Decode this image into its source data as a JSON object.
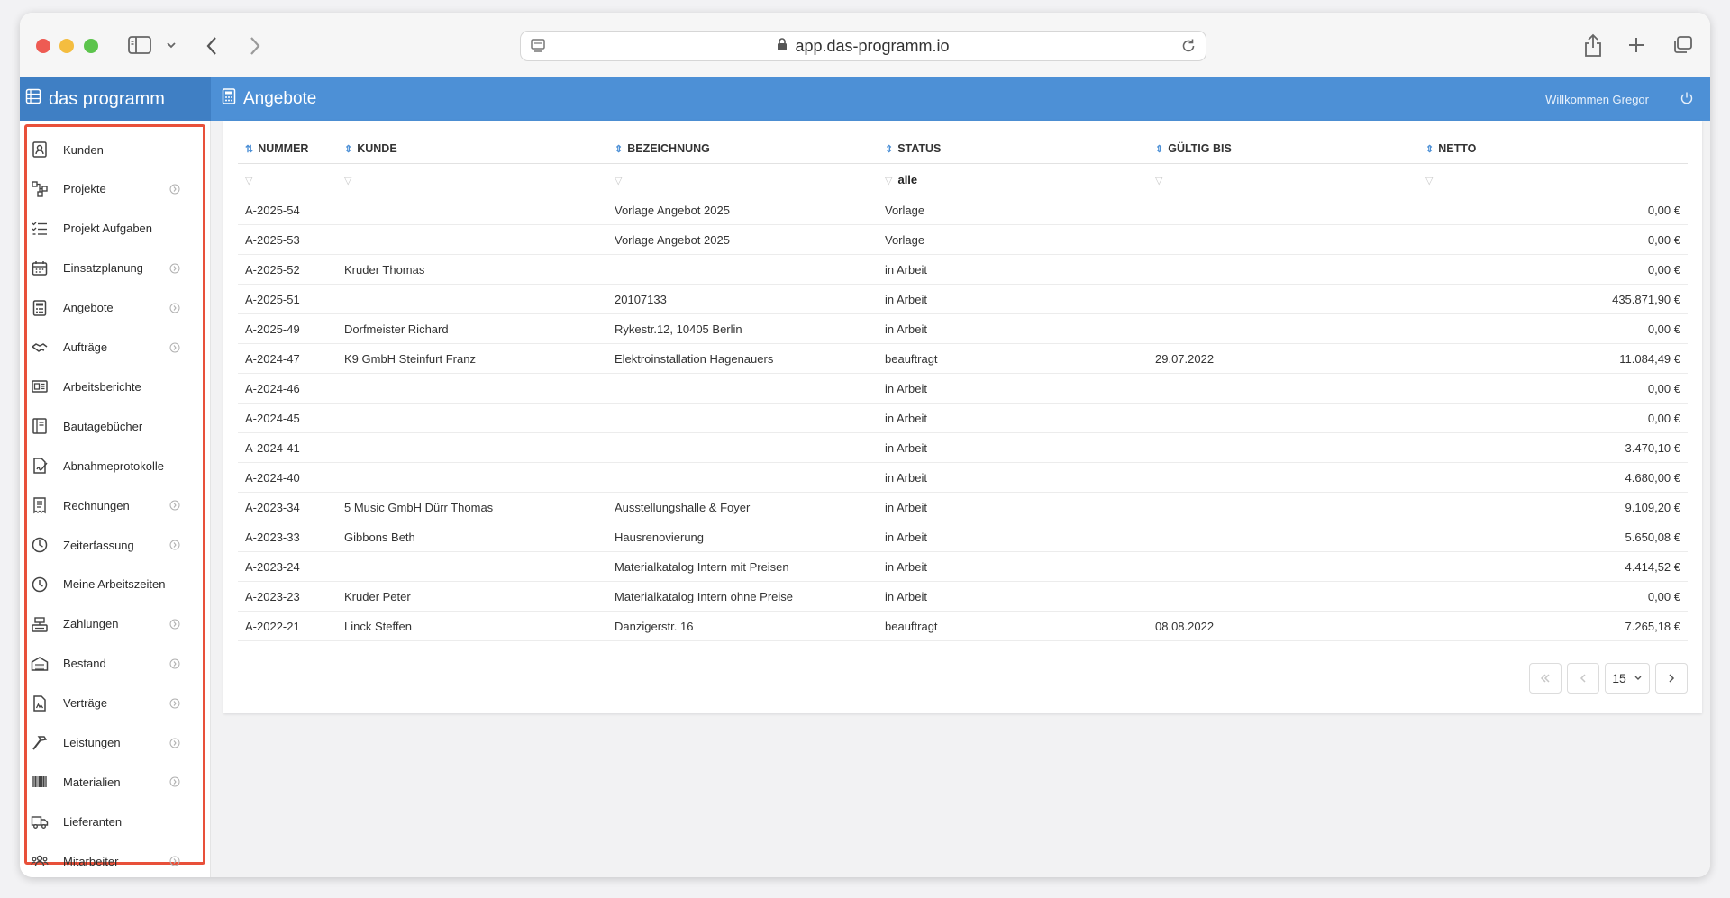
{
  "browser": {
    "url": "app.das-programm.io"
  },
  "app": {
    "brand": "das programm",
    "page_title": "Angebote",
    "welcome": "Willkommen Gregor"
  },
  "sidebar": {
    "items": [
      {
        "label": "Kunden",
        "icon": "contact-card-icon",
        "expandable": false
      },
      {
        "label": "Projekte",
        "icon": "project-tree-icon",
        "expandable": true
      },
      {
        "label": "Projekt Aufgaben",
        "icon": "task-list-icon",
        "expandable": false
      },
      {
        "label": "Einsatzplanung",
        "icon": "calendar-icon",
        "expandable": true
      },
      {
        "label": "Angebote",
        "icon": "calculator-icon",
        "expandable": true
      },
      {
        "label": "Aufträge",
        "icon": "handshake-icon",
        "expandable": true
      },
      {
        "label": "Arbeitsberichte",
        "icon": "report-icon",
        "expandable": false
      },
      {
        "label": "Bautagebücher",
        "icon": "logbook-icon",
        "expandable": false
      },
      {
        "label": "Abnahmeprotokolle",
        "icon": "signed-document-icon",
        "expandable": false
      },
      {
        "label": "Rechnungen",
        "icon": "invoice-icon",
        "expandable": true
      },
      {
        "label": "Zeiterfassung",
        "icon": "clock-icon",
        "expandable": true
      },
      {
        "label": "Meine Arbeitszeiten",
        "icon": "clock-icon",
        "expandable": false
      },
      {
        "label": "Zahlungen",
        "icon": "cash-register-icon",
        "expandable": true
      },
      {
        "label": "Bestand",
        "icon": "warehouse-icon",
        "expandable": true
      },
      {
        "label": "Verträge",
        "icon": "contract-icon",
        "expandable": true
      },
      {
        "label": "Leistungen",
        "icon": "hammer-icon",
        "expandable": true
      },
      {
        "label": "Materialien",
        "icon": "barcode-icon",
        "expandable": true
      },
      {
        "label": "Lieferanten",
        "icon": "truck-icon",
        "expandable": false
      },
      {
        "label": "Mitarbeiter",
        "icon": "users-icon",
        "expandable": true
      }
    ]
  },
  "table": {
    "columns": [
      "NUMMER",
      "KUNDE",
      "BEZEICHNUNG",
      "STATUS",
      "GÜLTIG BIS",
      "NETTO"
    ],
    "status_filter": "alle",
    "rows": [
      [
        "A-2025-54",
        "",
        "Vorlage Angebot 2025",
        "Vorlage",
        "",
        "0,00 €"
      ],
      [
        "A-2025-53",
        "",
        "Vorlage Angebot 2025",
        "Vorlage",
        "",
        "0,00 €"
      ],
      [
        "A-2025-52",
        "Kruder Thomas",
        "",
        "in Arbeit",
        "",
        "0,00 €"
      ],
      [
        "A-2025-51",
        "",
        "20107133",
        "in Arbeit",
        "",
        "435.871,90 €"
      ],
      [
        "A-2025-49",
        "Dorfmeister Richard",
        "Rykestr.12, 10405 Berlin",
        "in Arbeit",
        "",
        "0,00 €"
      ],
      [
        "A-2024-47",
        "K9 GmbH Steinfurt Franz",
        "Elektroinstallation Hagenauers",
        "beauftragt",
        "29.07.2022",
        "11.084,49 €"
      ],
      [
        "A-2024-46",
        "",
        "",
        "in Arbeit",
        "",
        "0,00 €"
      ],
      [
        "A-2024-45",
        "",
        "",
        "in Arbeit",
        "",
        "0,00 €"
      ],
      [
        "A-2024-41",
        "",
        "",
        "in Arbeit",
        "",
        "3.470,10 €"
      ],
      [
        "A-2024-40",
        "",
        "",
        "in Arbeit",
        "",
        "4.680,00 €"
      ],
      [
        "A-2023-34",
        "5 Music GmbH Dürr Thomas",
        "Ausstellungshalle & Foyer",
        "in Arbeit",
        "",
        "9.109,20 €"
      ],
      [
        "A-2023-33",
        "Gibbons Beth",
        "Hausrenovierung",
        "in Arbeit",
        "",
        "5.650,08 €"
      ],
      [
        "A-2023-24",
        "",
        "Materialkatalog Intern mit Preisen",
        "in Arbeit",
        "",
        "4.414,52 €"
      ],
      [
        "A-2023-23",
        "Kruder Peter",
        "Materialkatalog Intern ohne Preise",
        "in Arbeit",
        "",
        "0,00 €"
      ],
      [
        "A-2022-21",
        "Linck Steffen",
        "Danzigerstr. 16",
        "beauftragt",
        "08.08.2022",
        "7.265,18 €"
      ]
    ]
  },
  "pagination": {
    "page_size": "15"
  },
  "colors": {
    "header_blue": "#4d90d6",
    "brand_blue": "#3f7fc4",
    "highlight_red": "#e8503a"
  }
}
